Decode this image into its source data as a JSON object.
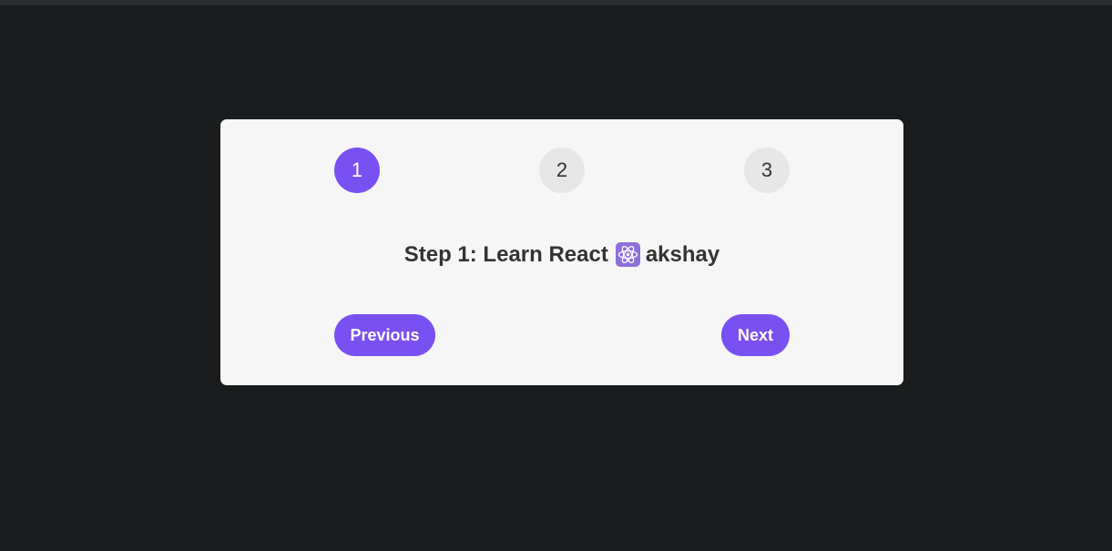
{
  "steps": {
    "items": [
      "1",
      "2",
      "3"
    ],
    "active_index": 0
  },
  "message": {
    "prefix": "Step 1: Learn React",
    "icon": "atom-icon",
    "suffix": "akshay"
  },
  "buttons": {
    "previous_label": "Previous",
    "next_label": "Next"
  },
  "colors": {
    "accent": "#7950f2",
    "background": "#1b1c1e",
    "card": "#f6f6f6",
    "inactive_step": "#e7e7e7",
    "text": "#333333"
  }
}
